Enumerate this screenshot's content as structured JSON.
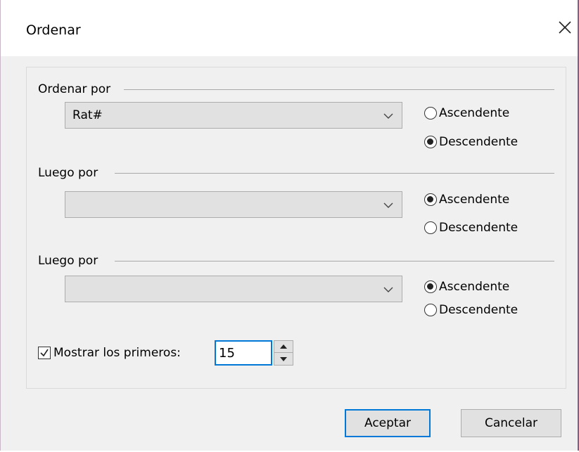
{
  "dialog": {
    "title": "Ordenar",
    "close_icon": "close-icon"
  },
  "groups": [
    {
      "label": "Ordenar por",
      "combo_value": "Rat#",
      "ascending_label": "Ascendente",
      "descending_label": "Descendente",
      "selected": "descending"
    },
    {
      "label": "Luego por",
      "combo_value": "",
      "ascending_label": "Ascendente",
      "descending_label": "Descendente",
      "selected": "ascending"
    },
    {
      "label": "Luego por",
      "combo_value": "",
      "ascending_label": "Ascendente",
      "descending_label": "Descendente",
      "selected": "ascending"
    }
  ],
  "show_first": {
    "label": "Mostrar los primeros:",
    "checked": true,
    "value": "15"
  },
  "buttons": {
    "ok_label": "Aceptar",
    "cancel_label": "Cancelar"
  },
  "colors": {
    "focus_accent": "#0078d7",
    "window_border": "#8a5b86"
  }
}
